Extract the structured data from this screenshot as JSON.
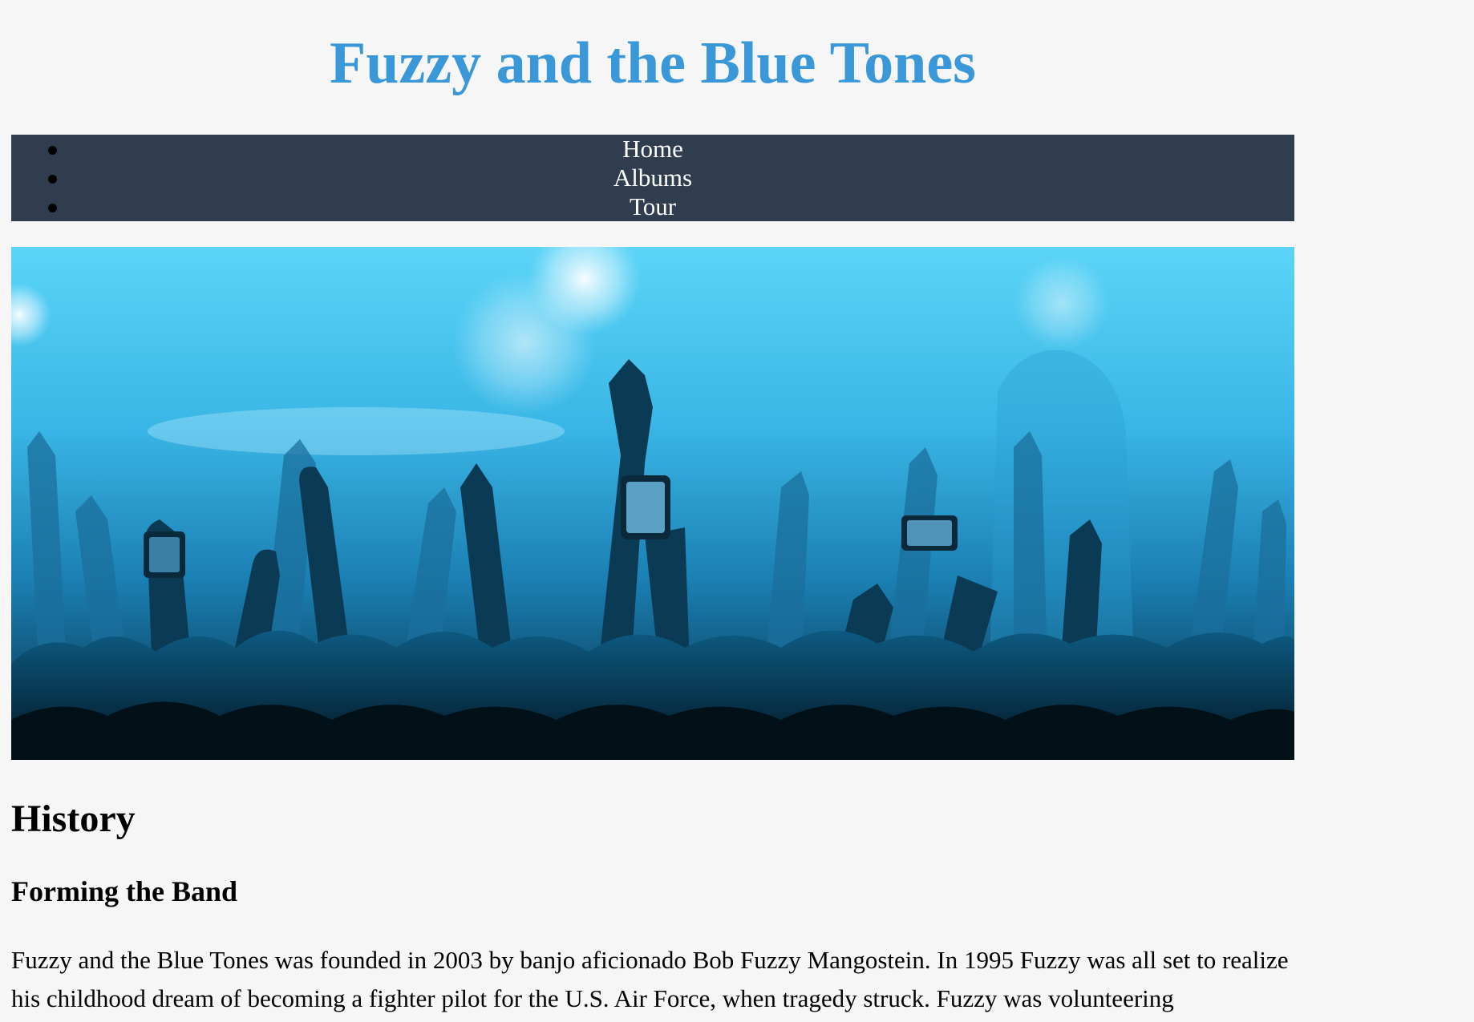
{
  "header": {
    "title": "Fuzzy and the Blue Tones"
  },
  "nav": {
    "items": [
      {
        "label": "Home"
      },
      {
        "label": "Albums"
      },
      {
        "label": "Tour"
      }
    ]
  },
  "hero": {
    "image_subject": "concert crowd with raised hands and phones under blue stage lights"
  },
  "content": {
    "heading": "History",
    "subheading": "Forming the Band",
    "paragraph": "Fuzzy and the Blue Tones was founded in 2003 by banjo aficionado Bob Fuzzy Mangostein. In 1995 Fuzzy was all set to realize his childhood dream of becoming a fighter pilot for the U.S. Air Force, when tragedy struck. Fuzzy was volunteering"
  },
  "colors": {
    "title": "#3a98d8",
    "nav_background": "#2f3d4f",
    "page_background": "#f6f6f6"
  }
}
